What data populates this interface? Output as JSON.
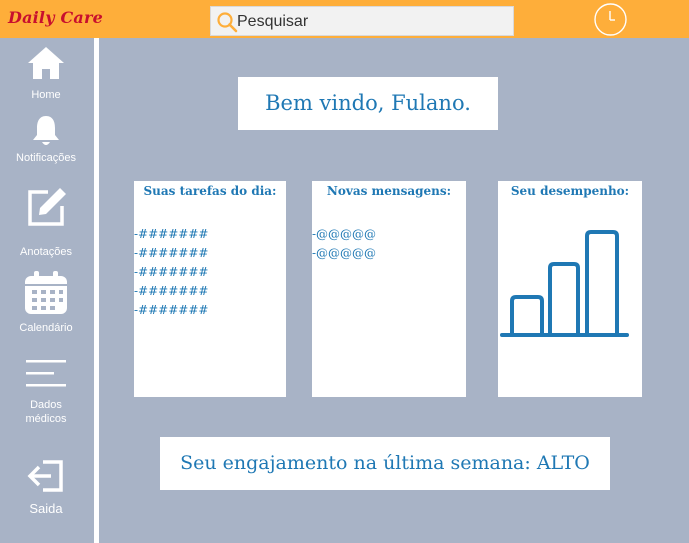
{
  "app": {
    "logo": "Daily Care"
  },
  "header": {
    "search_placeholder": "Pesquisar",
    "search_icon": "search-icon",
    "clock_icon": "clock-icon"
  },
  "sidebar": {
    "items": [
      {
        "label": "Home",
        "icon": "home-icon"
      },
      {
        "label": "Notificações",
        "icon": "bell-icon"
      },
      {
        "label": "Anotações",
        "icon": "edit-icon"
      },
      {
        "label": "Calendário",
        "icon": "calendar-icon"
      },
      {
        "label_line1": "Dados",
        "label_line2": "médicos",
        "icon": "menu-lines-icon"
      },
      {
        "label": "Saida",
        "icon": "logout-icon"
      }
    ]
  },
  "main": {
    "welcome": "Bem vindo, Fulano.",
    "tasks": {
      "title": "Suas tarefas do dia:",
      "items": [
        "-#######",
        "-#######",
        "-#######",
        "-#######",
        "-#######"
      ]
    },
    "messages": {
      "title": "Novas mensagens:",
      "items": [
        "-@@@@@",
        "-@@@@@"
      ]
    },
    "performance": {
      "title": "Seu desempenho:",
      "icon": "bar-chart-icon"
    },
    "engagement": "Seu engajamento na última semana: ALTO"
  },
  "colors": {
    "topbar": "#feae3a",
    "background": "#a8b3c6",
    "accent_text": "#1f78b4",
    "logo": "#c8102e"
  }
}
